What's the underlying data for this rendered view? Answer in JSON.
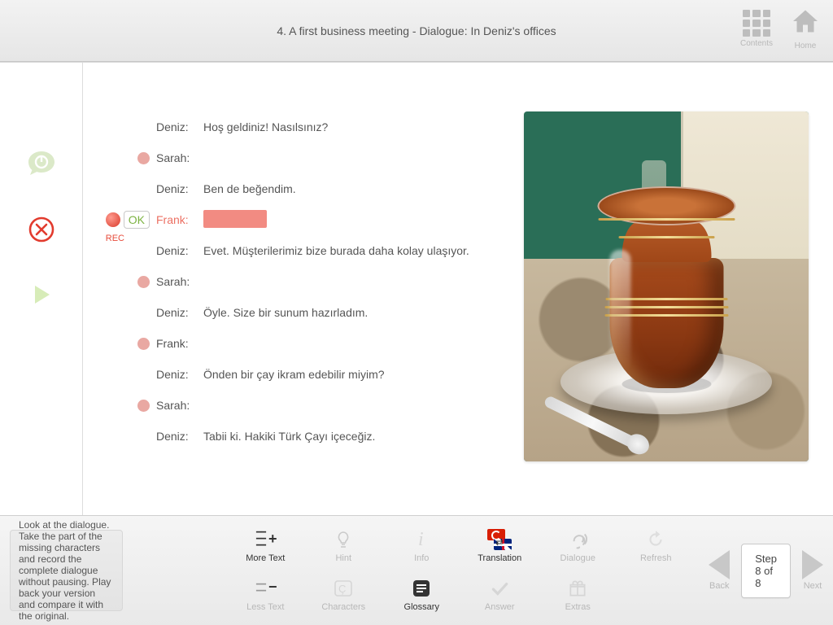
{
  "header": {
    "title": "4. A first business meeting - Dialogue: In Deniz's offices",
    "contents_label": "Contents",
    "home_label": "Home"
  },
  "left_rail": {
    "rec_label": "REC",
    "ok_label": "OK"
  },
  "dialogue": {
    "rows": [
      {
        "speaker": "Deniz:",
        "text": "Hoş geldiniz! Nasılsınız?"
      },
      {
        "speaker": "Sarah:",
        "text": ""
      },
      {
        "speaker": "Deniz:",
        "text": "Ben de beğendim."
      },
      {
        "speaker": "Frank:",
        "text": ""
      },
      {
        "speaker": "Deniz:",
        "text": "Evet. Müşterilerimiz bize burada daha kolay ulaşıyor."
      },
      {
        "speaker": "Sarah:",
        "text": ""
      },
      {
        "speaker": "Deniz:",
        "text": "Öyle. Size bir sunum hazırladım."
      },
      {
        "speaker": "Frank:",
        "text": ""
      },
      {
        "speaker": "Deniz:",
        "text": "Önden bir çay ikram edebilir miyim?"
      },
      {
        "speaker": "Sarah:",
        "text": ""
      },
      {
        "speaker": "Deniz:",
        "text": "Tabii ki. Hakiki Türk Çayı içeceğiz."
      }
    ],
    "active_index": 3
  },
  "instruction": "Look at the dialogue. Take the part of the missing characters and record the complete dialogue without pausing. Play back your version and compare it with the original.",
  "tools": {
    "more_text": "More Text",
    "less_text": "Less Text",
    "hint": "Hint",
    "characters": "Characters",
    "info": "Info",
    "glossary": "Glossary",
    "translation": "Translation",
    "answer": "Answer",
    "dialogue": "Dialogue",
    "extras": "Extras",
    "refresh": "Refresh"
  },
  "nav": {
    "back": "Back",
    "next": "Next",
    "step": "Step 8 of 8"
  }
}
